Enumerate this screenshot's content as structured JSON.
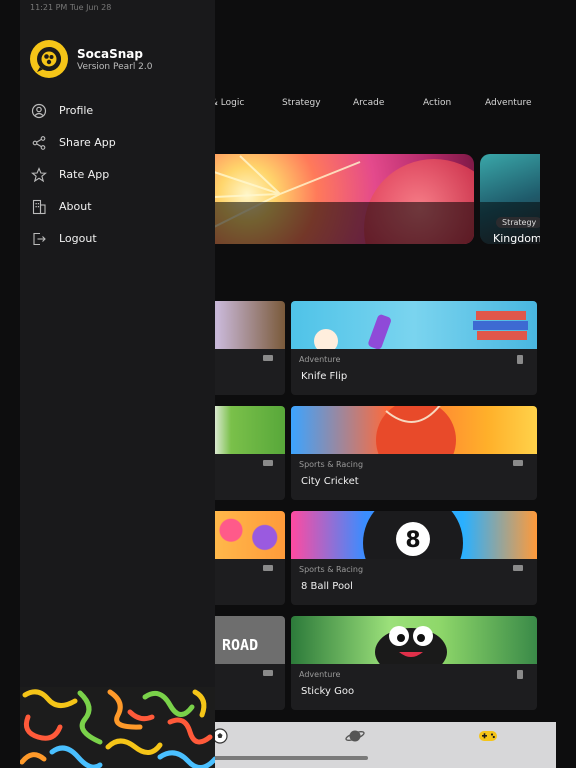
{
  "status_bar": {
    "time_date": "11:21 PM   Tue Jun 28"
  },
  "drawer": {
    "app_name": "SocaSnap",
    "version": "Version Pearl 2.0",
    "menu": [
      {
        "label": "Profile",
        "icon": "profile-icon"
      },
      {
        "label": "Share App",
        "icon": "share-icon"
      },
      {
        "label": "Rate App",
        "icon": "star-icon"
      },
      {
        "label": "About",
        "icon": "building-icon"
      },
      {
        "label": "Logout",
        "icon": "logout-icon"
      }
    ]
  },
  "categories": [
    "le & Logic",
    "Strategy",
    "Arcade",
    "Action",
    "Adventure"
  ],
  "featured": [
    {
      "category": "Strategy",
      "title": "Kingdom"
    }
  ],
  "games": [
    {
      "category": "Adventure",
      "title": "Knife Flip"
    },
    {
      "category": "Sports & Racing",
      "title": "City Cricket"
    },
    {
      "category": "Sports & Racing",
      "title": "8 Ball Pool"
    },
    {
      "category": "Adventure",
      "title": "Sticky Goo"
    }
  ],
  "left_thumb_text": "ROAD",
  "tabbar": [
    {
      "icon": "soccer-ball-icon"
    },
    {
      "icon": "planet-icon"
    },
    {
      "icon": "gamepad-icon",
      "active": true
    }
  ],
  "colors": {
    "accent": "#f5c518",
    "drawer_bg": "#19191b",
    "card_bg": "#1d1d1f"
  }
}
